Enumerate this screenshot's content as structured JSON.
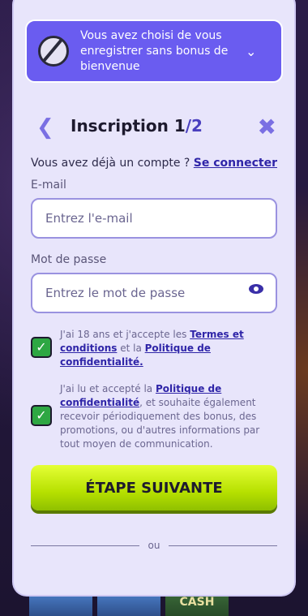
{
  "banner": {
    "text": "Vous avez choisi de vous enregistrer sans bonus de bienvenue",
    "icon": "no-bonus-icon",
    "expand_icon": "chevron-down-icon"
  },
  "header": {
    "title": "Inscription 1",
    "step": "/2",
    "back_icon": "chevron-left-icon",
    "close_icon": "close-icon"
  },
  "account": {
    "prompt": "Vous avez déjà un compte ?",
    "login_link": "Se connecter"
  },
  "form": {
    "email_label": "E-mail",
    "email_placeholder": "Entrez l'e-mail",
    "email_value": "",
    "password_label": "Mot de passe",
    "password_placeholder": "Entrez le mot de passe",
    "password_value": ""
  },
  "consent1": {
    "text1": "J'ai 18 ans et j'accepte les",
    "terms_link": "Termes et conditions",
    "text2": "et la",
    "privacy_link": "Politique de confidentialité.",
    "checked": true
  },
  "consent2": {
    "text1": "J'ai lu et accepté la",
    "privacy_link": "Politique de confidentialité",
    "text2": ", et souhaite également recevoir périodiquement des bonus, des promotions, ou d'autres informations par tout moyen de communication.",
    "checked": true
  },
  "next_button": "ÉTAPE SUIVANTE",
  "divider_or": "ou",
  "background": {
    "tile_label": "CASH"
  },
  "colors": {
    "banner": "#6a5cf0",
    "accent": "#7a6fe3",
    "next_button": "#c8ee00",
    "checkbox": "#2ea743"
  }
}
